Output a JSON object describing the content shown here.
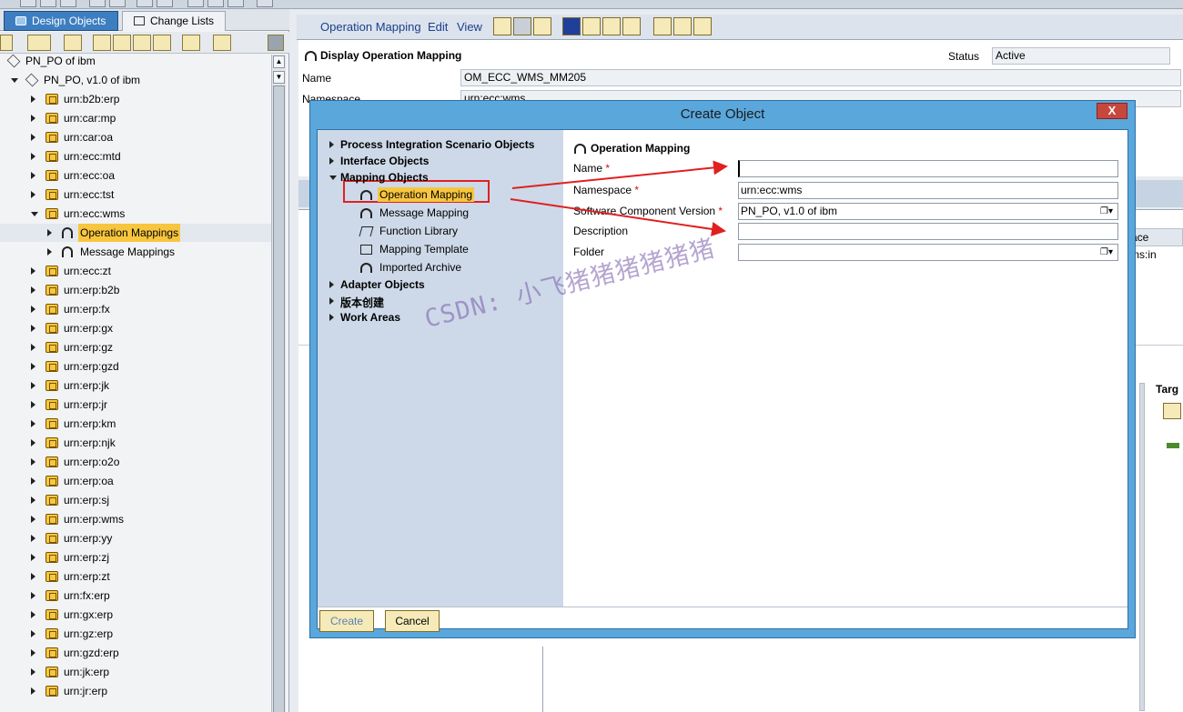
{
  "left_panel": {
    "tabs": [
      {
        "label": "Design Objects",
        "active": true
      },
      {
        "label": "Change Lists",
        "active": false
      }
    ],
    "tree": [
      {
        "label": "PN_PO of ibm",
        "level": 0,
        "icon": "swc-icon"
      },
      {
        "label": "PN_PO, v1.0 of ibm",
        "level": 1,
        "icon": "swcv-icon",
        "expanded": true
      },
      {
        "label": "urn:b2b:erp",
        "level": 2,
        "icon": "namespace-icon"
      },
      {
        "label": "urn:car:mp",
        "level": 2,
        "icon": "namespace-icon"
      },
      {
        "label": "urn:car:oa",
        "level": 2,
        "icon": "namespace-icon"
      },
      {
        "label": "urn:ecc:mtd",
        "level": 2,
        "icon": "namespace-icon"
      },
      {
        "label": "urn:ecc:oa",
        "level": 2,
        "icon": "namespace-icon"
      },
      {
        "label": "urn:ecc:tst",
        "level": 2,
        "icon": "namespace-icon"
      },
      {
        "label": "urn:ecc:wms",
        "level": 2,
        "icon": "namespace-icon",
        "expanded": true
      },
      {
        "label": "Operation Mappings",
        "level": 3,
        "icon": "operation-mapping-icon",
        "selected": true
      },
      {
        "label": "Message Mappings",
        "level": 3,
        "icon": "message-mapping-icon"
      },
      {
        "label": "urn:ecc:zt",
        "level": 2,
        "icon": "namespace-icon"
      },
      {
        "label": "urn:erp:b2b",
        "level": 2,
        "icon": "namespace-icon"
      },
      {
        "label": "urn:erp:fx",
        "level": 2,
        "icon": "namespace-icon"
      },
      {
        "label": "urn:erp:gx",
        "level": 2,
        "icon": "namespace-icon"
      },
      {
        "label": "urn:erp:gz",
        "level": 2,
        "icon": "namespace-icon"
      },
      {
        "label": "urn:erp:gzd",
        "level": 2,
        "icon": "namespace-icon"
      },
      {
        "label": "urn:erp:jk",
        "level": 2,
        "icon": "namespace-icon"
      },
      {
        "label": "urn:erp:jr",
        "level": 2,
        "icon": "namespace-icon"
      },
      {
        "label": "urn:erp:km",
        "level": 2,
        "icon": "namespace-icon"
      },
      {
        "label": "urn:erp:njk",
        "level": 2,
        "icon": "namespace-icon"
      },
      {
        "label": "urn:erp:o2o",
        "level": 2,
        "icon": "namespace-icon"
      },
      {
        "label": "urn:erp:oa",
        "level": 2,
        "icon": "namespace-icon"
      },
      {
        "label": "urn:erp:sj",
        "level": 2,
        "icon": "namespace-icon"
      },
      {
        "label": "urn:erp:wms",
        "level": 2,
        "icon": "namespace-icon"
      },
      {
        "label": "urn:erp:yy",
        "level": 2,
        "icon": "namespace-icon"
      },
      {
        "label": "urn:erp:zj",
        "level": 2,
        "icon": "namespace-icon"
      },
      {
        "label": "urn:erp:zt",
        "level": 2,
        "icon": "namespace-icon"
      },
      {
        "label": "urn:fx:erp",
        "level": 2,
        "icon": "namespace-icon"
      },
      {
        "label": "urn:gx:erp",
        "level": 2,
        "icon": "namespace-icon"
      },
      {
        "label": "urn:gz:erp",
        "level": 2,
        "icon": "namespace-icon"
      },
      {
        "label": "urn:gzd:erp",
        "level": 2,
        "icon": "namespace-icon"
      },
      {
        "label": "urn:jk:erp",
        "level": 2,
        "icon": "namespace-icon"
      },
      {
        "label": "urn:jr:erp",
        "level": 2,
        "icon": "namespace-icon"
      }
    ]
  },
  "main": {
    "menu": [
      "Operation Mapping",
      "Edit",
      "View"
    ],
    "header": {
      "title": "Display Operation Mapping",
      "name_label": "Name",
      "name_value": "OM_ECC_WMS_MM205",
      "namespace_label": "Namespace",
      "namespace_value": "urn:ecc:wms",
      "status_label": "Status",
      "status_value": "Active"
    },
    "partial_texts": {
      "interface_col": "ace",
      "interface_val": "ms:in",
      "target": "Targ"
    }
  },
  "dialog": {
    "title": "Create Object",
    "close_label": "X",
    "categories": [
      {
        "label": "Process Integration Scenario Objects",
        "expanded": false
      },
      {
        "label": "Interface Objects",
        "expanded": false
      },
      {
        "label": "Mapping Objects",
        "expanded": true,
        "children": [
          {
            "label": "Operation Mapping",
            "icon": "operation-mapping-icon",
            "selected": true
          },
          {
            "label": "Message Mapping",
            "icon": "message-mapping-icon"
          },
          {
            "label": "Function Library",
            "icon": "function-library-icon"
          },
          {
            "label": "Mapping Template",
            "icon": "mapping-template-icon"
          },
          {
            "label": "Imported Archive",
            "icon": "imported-archive-icon"
          }
        ]
      },
      {
        "label": "Adapter Objects",
        "expanded": false
      },
      {
        "label": "版本创建",
        "expanded": false
      },
      {
        "label": "Work Areas",
        "expanded": false
      }
    ],
    "form": {
      "heading": "Operation Mapping",
      "fields": [
        {
          "label": "Name",
          "required": true,
          "value": ""
        },
        {
          "label": "Namespace",
          "required": true,
          "value": "urn:ecc:wms"
        },
        {
          "label": "Software Component Version",
          "required": true,
          "value": "PN_PO, v1.0 of ibm",
          "has_button": true
        },
        {
          "label": "Description",
          "required": false,
          "value": ""
        },
        {
          "label": "Folder",
          "required": false,
          "value": "",
          "has_button": true
        }
      ]
    },
    "buttons": {
      "create": "Create",
      "cancel": "Cancel"
    }
  },
  "watermark": "CSDN: 小飞猪猪猪猪猪猪",
  "colors": {
    "selected": "#f7c63e",
    "dialog_frame": "#5aa7dc",
    "annotation": "#e02020",
    "tab_active": "#3d7ec0"
  }
}
